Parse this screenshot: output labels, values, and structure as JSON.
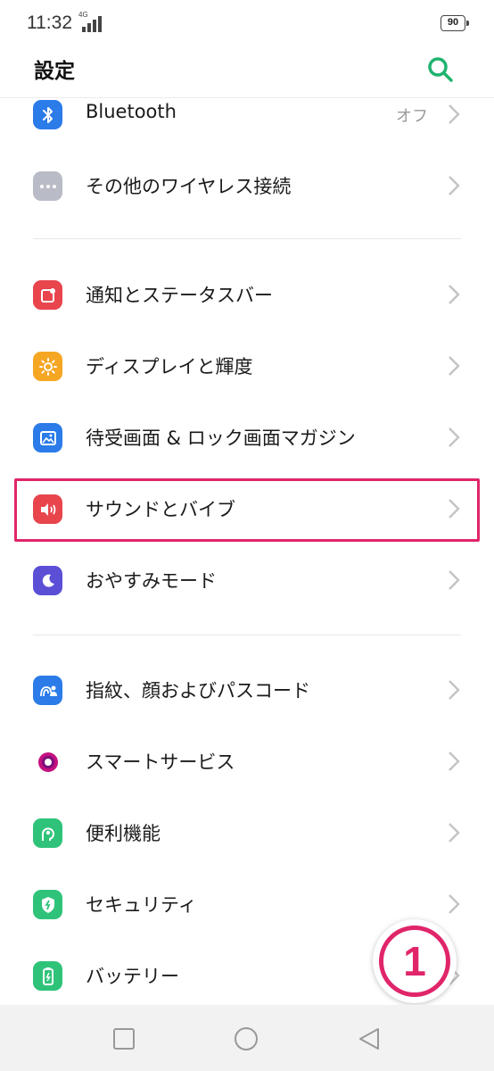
{
  "status_bar": {
    "time": "11:32",
    "network": "4G",
    "battery": "90"
  },
  "header": {
    "title": "設定"
  },
  "rows": [
    {
      "label": "Bluetooth",
      "value": "オフ"
    },
    {
      "label": "その他のワイヤレス接続",
      "value": ""
    },
    {
      "label": "通知とステータスバー",
      "value": ""
    },
    {
      "label": "ディスプレイと輝度",
      "value": ""
    },
    {
      "label": "待受画面 & ロック画面マガジン",
      "value": ""
    },
    {
      "label": "サウンドとバイブ",
      "value": ""
    },
    {
      "label": "おやすみモード",
      "value": ""
    },
    {
      "label": "指紋、顔およびパスコード",
      "value": ""
    },
    {
      "label": "スマートサービス",
      "value": ""
    },
    {
      "label": "便利機能",
      "value": ""
    },
    {
      "label": "セキュリティ",
      "value": ""
    },
    {
      "label": "バッテリー",
      "value": ""
    }
  ],
  "annotation": {
    "step": "1"
  },
  "colors": {
    "accent": "#20b36f",
    "highlight": "#e0256a"
  },
  "icons": [
    "bluetooth-icon",
    "more-icon",
    "notification-icon",
    "brightness-icon",
    "wallpaper-icon",
    "speaker-icon",
    "moon-icon",
    "fingerprint-user-icon",
    "smart-service-icon",
    "convenience-icon",
    "shield-icon",
    "battery-icon"
  ]
}
